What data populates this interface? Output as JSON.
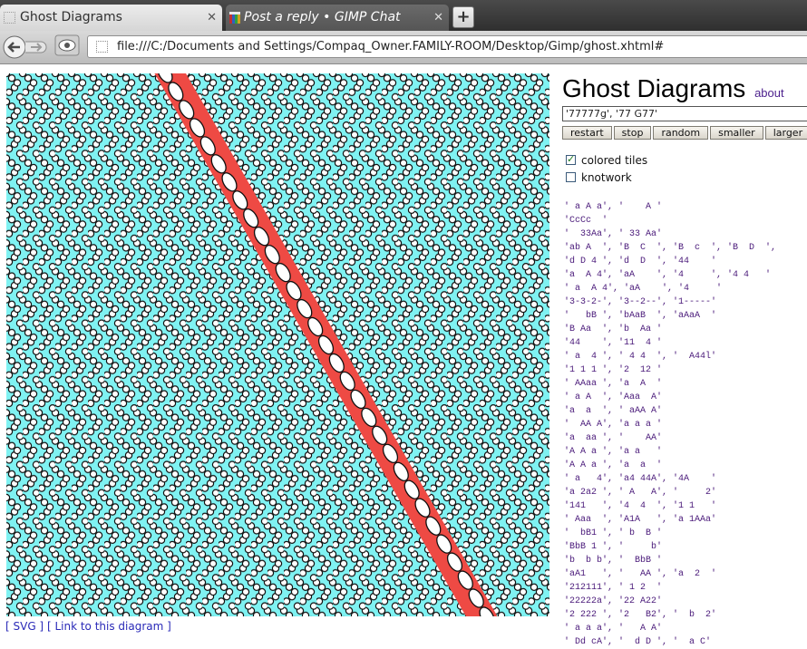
{
  "browser": {
    "tabs": [
      {
        "title": "Ghost Diagrams",
        "close": "✕"
      },
      {
        "title": "Post a reply • GIMP Chat",
        "close": "✕"
      }
    ],
    "new_tab_label": "+",
    "url": "file:///C:/Documents and Settings/Compaq_Owner.FAMILY-ROOM/Desktop/Gimp/ghost.xhtml#"
  },
  "colors": {
    "tile_fill": "#7ff2f2",
    "band_fill": "#ee4a44",
    "link_purple": "#4b1f8c"
  },
  "page": {
    "title": "Ghost Diagrams",
    "about_label": "about",
    "code_value": "'77777g', '77 G77'",
    "buttons": [
      "restart",
      "stop",
      "random",
      "smaller",
      "larger"
    ],
    "options": [
      {
        "label": "colored tiles",
        "checked": true
      },
      {
        "label": "knotwork",
        "checked": false
      }
    ],
    "links": {
      "svg": "[ SVG ]",
      "link": "[ Link to this diagram ]"
    },
    "tile_specs": [
      "' a A a', '    A '",
      "'CcCc  '",
      "'  33Aa', ' 33 Aa'",
      "'ab A  ', 'B  C  ', 'B  c  ', 'B  D  ',",
      "'d D 4 ', 'd  D  ', '44    '",
      "'a  A 4', 'aA    ', '4     ', '4 4   '",
      "' a  A 4', 'aA    ', '4     '",
      "'3-3-2-', '3--2--', '1-----'",
      "'   bB ', 'bAaB  ', 'aAaA  '",
      "'B Aa  ', 'b  Aa '",
      "'44    ', '11  4 '",
      "' a  4 ', ' 4 4  ', '  A44l'",
      "'1 1 1 ', '2  12 '",
      "' AAaa ', 'a  A  '",
      "' a A  ', 'Aaa  A'",
      "'a  a  ', ' aAA A'",
      "'  AA A', 'a a a '",
      "'a  aa ', '    AA'",
      "'A A a ', 'a a   '",
      "'A A a ', 'a  a  '",
      "' a   4', 'a4 44A', '4A    '",
      "'a 2a2 ', ' A   A', '     2'",
      "'141   ', '4  4  ', '1 1   '",
      "' Aaa  ', 'A1A   ', 'a 1AAa'",
      "'  bB1 ', ' b  B '",
      "'BbB 1 ', '     b'",
      "'b  b b', '  BbB '",
      "'aA1   ', '   AA ', 'a  2  '",
      "'212111', ' 1 2  '",
      "'22222a', '22 A22'",
      "'2 222 ', '2   B2', '  b  2'",
      "' a a a', '   A A'",
      "' Dd cA', '  d D ', '  a C'"
    ]
  }
}
